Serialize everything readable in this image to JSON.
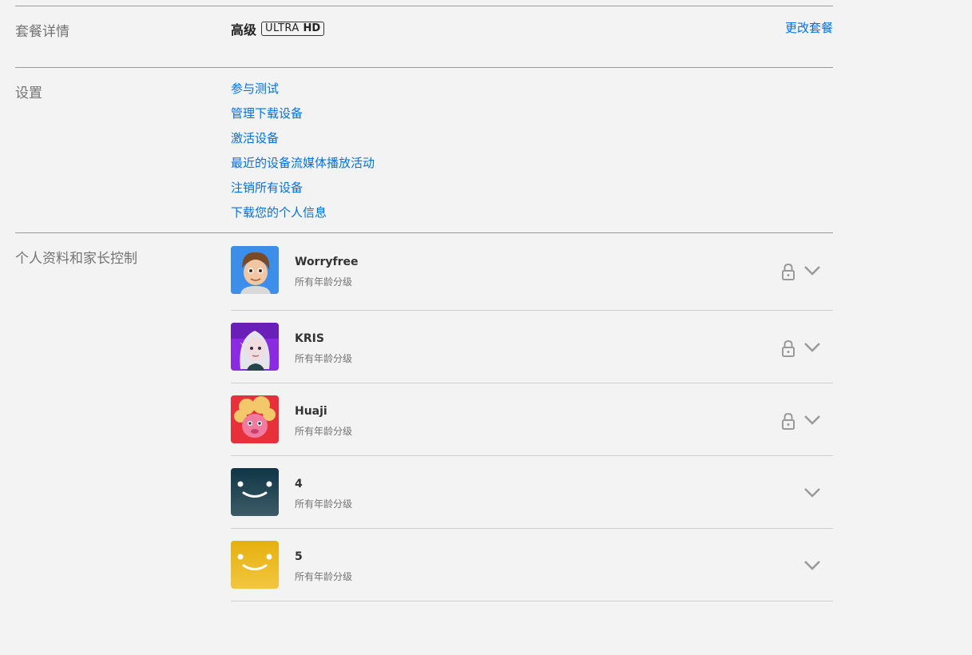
{
  "plan": {
    "section_title": "套餐详情",
    "plan_name": "高级",
    "badge_ultra": "ULTRA",
    "badge_hd": "HD",
    "change_plan_label": "更改套餐"
  },
  "settings": {
    "section_title": "设置",
    "links": [
      "参与测试",
      "管理下载设备",
      "激活设备",
      "最近的设备流媒体播放活动",
      "注销所有设备",
      "下载您的个人信息"
    ]
  },
  "profiles": {
    "section_title": "个人资料和家长控制",
    "items": [
      {
        "name": "Worryfree",
        "rating": "所有年龄分级",
        "locked": true,
        "avatar": "cartoon-boy-avatar",
        "avatar_color": "#3d8ee8"
      },
      {
        "name": "KRIS",
        "rating": "所有年龄分级",
        "locked": true,
        "avatar": "elf-girl-avatar",
        "avatar_color": "#8a2be2"
      },
      {
        "name": "Huaji",
        "rating": "所有年龄分级",
        "locked": true,
        "avatar": "pink-creature-avatar",
        "avatar_color": "#e8303a"
      },
      {
        "name": "4",
        "rating": "所有年龄分级",
        "locked": false,
        "avatar": "smiley-dark-teal-avatar",
        "avatar_color": "#1f4552"
      },
      {
        "name": "5",
        "rating": "所有年龄分级",
        "locked": false,
        "avatar": "smiley-yellow-avatar",
        "avatar_color": "#e8b51c"
      }
    ]
  },
  "colors": {
    "link": "#0071eb",
    "background": "#f3f3f3",
    "muted_text": "#737373"
  }
}
